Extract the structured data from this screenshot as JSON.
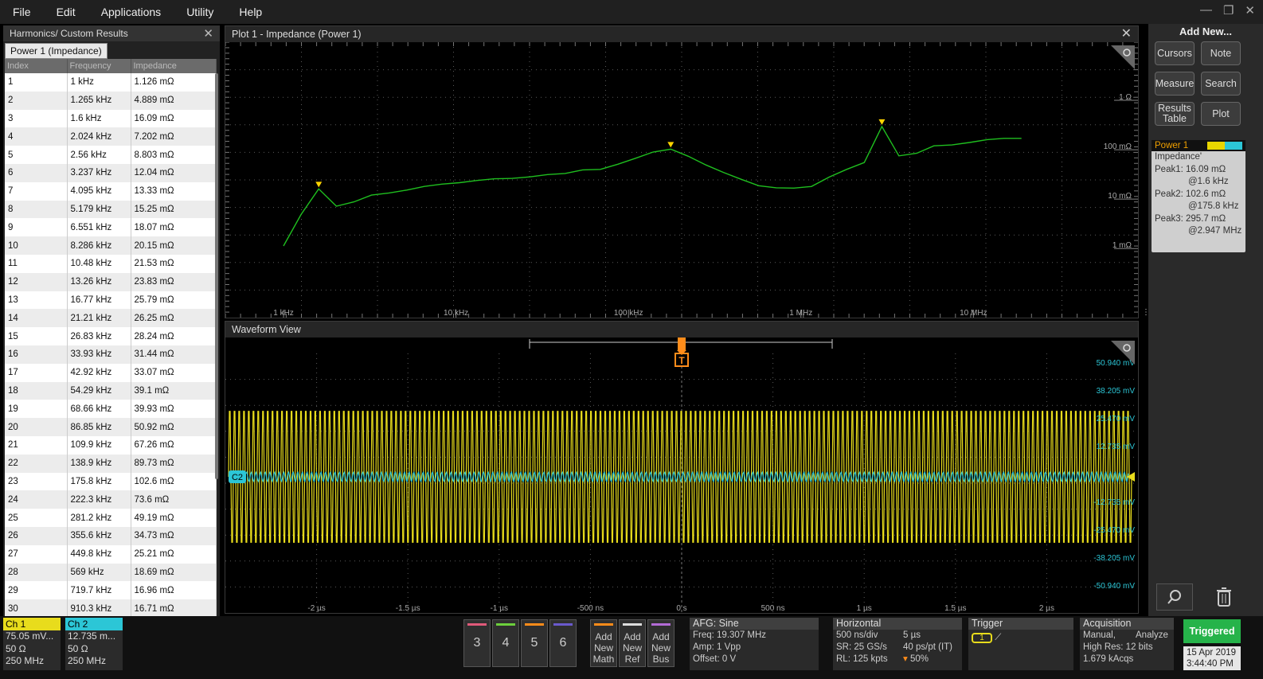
{
  "menu": [
    "File",
    "Edit",
    "Applications",
    "Utility",
    "Help"
  ],
  "results": {
    "title": "Harmonics/ Custom Results",
    "tab": "Power 1 (Impedance)",
    "columns": [
      "Index",
      "Frequency",
      "Impedance"
    ],
    "rows": [
      [
        "1",
        "1 kHz",
        "1.126 mΩ"
      ],
      [
        "2",
        "1.265 kHz",
        "4.889 mΩ"
      ],
      [
        "3",
        "1.6 kHz",
        "16.09 mΩ"
      ],
      [
        "4",
        "2.024 kHz",
        "7.202 mΩ"
      ],
      [
        "5",
        "2.56 kHz",
        "8.803 mΩ"
      ],
      [
        "6",
        "3.237 kHz",
        "12.04 mΩ"
      ],
      [
        "7",
        "4.095 kHz",
        "13.33 mΩ"
      ],
      [
        "8",
        "5.179 kHz",
        "15.25 mΩ"
      ],
      [
        "9",
        "6.551 kHz",
        "18.07 mΩ"
      ],
      [
        "10",
        "8.286 kHz",
        "20.15 mΩ"
      ],
      [
        "11",
        "10.48 kHz",
        "21.53 mΩ"
      ],
      [
        "12",
        "13.26 kHz",
        "23.83 mΩ"
      ],
      [
        "13",
        "16.77 kHz",
        "25.79 mΩ"
      ],
      [
        "14",
        "21.21 kHz",
        "26.25 mΩ"
      ],
      [
        "15",
        "26.83 kHz",
        "28.24 mΩ"
      ],
      [
        "16",
        "33.93 kHz",
        "31.44 mΩ"
      ],
      [
        "17",
        "42.92 kHz",
        "33.07 mΩ"
      ],
      [
        "18",
        "54.29 kHz",
        "39.1 mΩ"
      ],
      [
        "19",
        "68.66 kHz",
        "39.93 mΩ"
      ],
      [
        "20",
        "86.85 kHz",
        "50.92 mΩ"
      ],
      [
        "21",
        "109.9 kHz",
        "67.26 mΩ"
      ],
      [
        "22",
        "138.9 kHz",
        "89.73 mΩ"
      ],
      [
        "23",
        "175.8 kHz",
        "102.6 mΩ"
      ],
      [
        "24",
        "222.3 kHz",
        "73.6 mΩ"
      ],
      [
        "25",
        "281.2 kHz",
        "49.19 mΩ"
      ],
      [
        "26",
        "355.6 kHz",
        "34.73 mΩ"
      ],
      [
        "27",
        "449.8 kHz",
        "25.21 mΩ"
      ],
      [
        "28",
        "569 kHz",
        "18.69 mΩ"
      ],
      [
        "29",
        "719.7 kHz",
        "16.96 mΩ"
      ],
      [
        "30",
        "910.3 kHz",
        "16.71 mΩ"
      ]
    ]
  },
  "plot": {
    "title": "Plot 1 - Impedance (Power 1)",
    "y_ticks": [
      "1 Ω",
      "100 mΩ",
      "10 mΩ",
      "1 mΩ"
    ],
    "x_ticks": [
      "1 kHz",
      "10 kHz",
      "100 kHz",
      "1 MHz",
      "10 MHz"
    ]
  },
  "chart_data": {
    "type": "line",
    "x_scale": "log",
    "y_scale": "log",
    "x": [
      1000,
      1265,
      1600,
      2024,
      2560,
      3237,
      4095,
      5179,
      6551,
      8286,
      10480,
      13260,
      16770,
      21210,
      26830,
      33930,
      42920,
      54290,
      68660,
      86850,
      109900,
      138900,
      175800,
      222300,
      281200,
      355600,
      449800,
      569000,
      719700,
      910300,
      1150000,
      1460000,
      1840000,
      2330000,
      2947000,
      3700000,
      4700000,
      5900000,
      7500000,
      9500000,
      12000000,
      15000000,
      19000000
    ],
    "y": [
      0.001126,
      0.004889,
      0.01609,
      0.007202,
      0.008803,
      0.01204,
      0.01333,
      0.01525,
      0.01807,
      0.02015,
      0.02153,
      0.02383,
      0.02579,
      0.02625,
      0.02824,
      0.03144,
      0.03307,
      0.0391,
      0.03993,
      0.05092,
      0.06726,
      0.08973,
      0.1026,
      0.0736,
      0.04919,
      0.03473,
      0.02521,
      0.01869,
      0.01696,
      0.01671,
      0.018,
      0.028,
      0.04,
      0.055,
      0.2957,
      0.075,
      0.085,
      0.12,
      0.125,
      0.14,
      0.16,
      0.17,
      0.17
    ],
    "peaks_x": [
      1600,
      175800,
      2947000
    ],
    "xlim": [
      460,
      90000000
    ],
    "ylim": [
      4e-05,
      15
    ],
    "color": "#1fbf1f",
    "marker_color": "#ffd400"
  },
  "waveform": {
    "title": "Waveform View",
    "trigger_label": "T",
    "ch2_label": "C2",
    "x_ticks": [
      "-2 µs",
      "-1.5 µs",
      "-1 µs",
      "-500 ns",
      "0 s",
      "500 ns",
      "1 µs",
      "1.5 µs",
      "2 µs"
    ],
    "y_ticks": [
      "50.940 mV",
      "38.205 mV",
      "25.470 mV",
      "12.735 mV",
      "-12.735 mV",
      "-25.470 mV",
      "-38.205 mV",
      "-50.940 mV"
    ],
    "ch1_color": "#e8dc1c",
    "ch2_color": "#2cc6d6"
  },
  "right_panel": {
    "title": "Add New...",
    "buttons": [
      "Cursors",
      "Note",
      "Measure",
      "Search",
      "Results Table",
      "Plot"
    ],
    "badge": {
      "title": "Power 1",
      "measure": "Impedance'",
      "peak1_label": "Peak1:",
      "peak1_value": "16.09 mΩ",
      "peak1_at": "@1.6 kHz",
      "peak2_label": "Peak2:",
      "peak2_value": "102.6 mΩ",
      "peak2_at": "@175.8 kHz",
      "peak3_label": "Peak3:",
      "peak3_value": "295.7 mΩ",
      "peak3_at": "@2.947 MHz"
    }
  },
  "bottom": {
    "ch1": {
      "label": "Ch 1",
      "scale": "75.05 mV...",
      "imp": "50 Ω",
      "bw": "250 MHz",
      "color": "#e8dc1c"
    },
    "ch2": {
      "label": "Ch 2",
      "scale": "12.735 m...",
      "imp": "50 Ω",
      "bw": "250 MHz",
      "color": "#2cc6d6"
    },
    "num_buttons": [
      "3",
      "4",
      "5",
      "6"
    ],
    "num_colors": [
      "#e05a7a",
      "#6ccf3c",
      "#ff8c1a",
      "#6a5acd"
    ],
    "add_buttons": [
      "Add New Math",
      "Add New Ref",
      "Add New Bus"
    ],
    "add_colors": [
      "#ff8c1a",
      "#dddddd",
      "#b36bd6"
    ],
    "afg": {
      "title": "AFG: Sine",
      "freq": "Freq: 19.307 MHz",
      "amp": "Amp: 1 Vpp",
      "offset": "Offset: 0 V"
    },
    "horizontal": {
      "title": "Horizontal",
      "div": "500 ns/div",
      "span": "5 µs",
      "sr": "SR: 25 GS/s",
      "pt": "40 ps/pt (IT)",
      "rl": "RL: 125 kpts",
      "pos": "50%"
    },
    "trigger": {
      "title": "Trigger",
      "source": "1"
    },
    "acquisition": {
      "title": "Acquisition",
      "mode": "Manual,",
      "analyze": "Analyze",
      "res": "High Res: 12 bits",
      "acqs": "1.679 kAcqs"
    },
    "status": "Triggered",
    "date": "15 Apr 2019",
    "time": "3:44:40 PM"
  }
}
